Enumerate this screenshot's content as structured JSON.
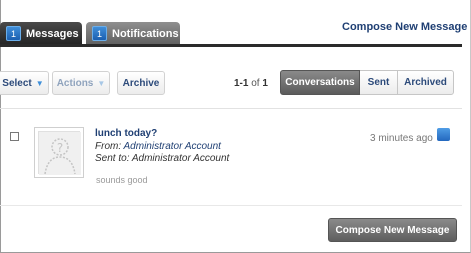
{
  "tabs": [
    {
      "label": "Messages",
      "count": "1",
      "active": true
    },
    {
      "label": "Notifications",
      "count": "1",
      "active": false
    }
  ],
  "header": {
    "compose_link": "Compose New Message"
  },
  "toolbar": {
    "select_label": "Select",
    "actions_label": "Actions",
    "archive_label": "Archive",
    "caret": "▼"
  },
  "pager": {
    "range": "1-1",
    "of": "of",
    "total": "1"
  },
  "filters": {
    "conversations": "Conversations",
    "sent": "Sent",
    "archived": "Archived"
  },
  "message": {
    "subject": "lunch today?",
    "from_prefix": "From: ",
    "from_name": "Administrator Account",
    "to_prefix": "Sent to: ",
    "to_name": "Administrator Account",
    "preview": "sounds good",
    "time": "3 minutes ago"
  },
  "footer": {
    "compose_button": "Compose New Message"
  },
  "colors": {
    "accent_blue": "#2368be",
    "link": "#1f3f73",
    "dark_tab": "#232323"
  }
}
